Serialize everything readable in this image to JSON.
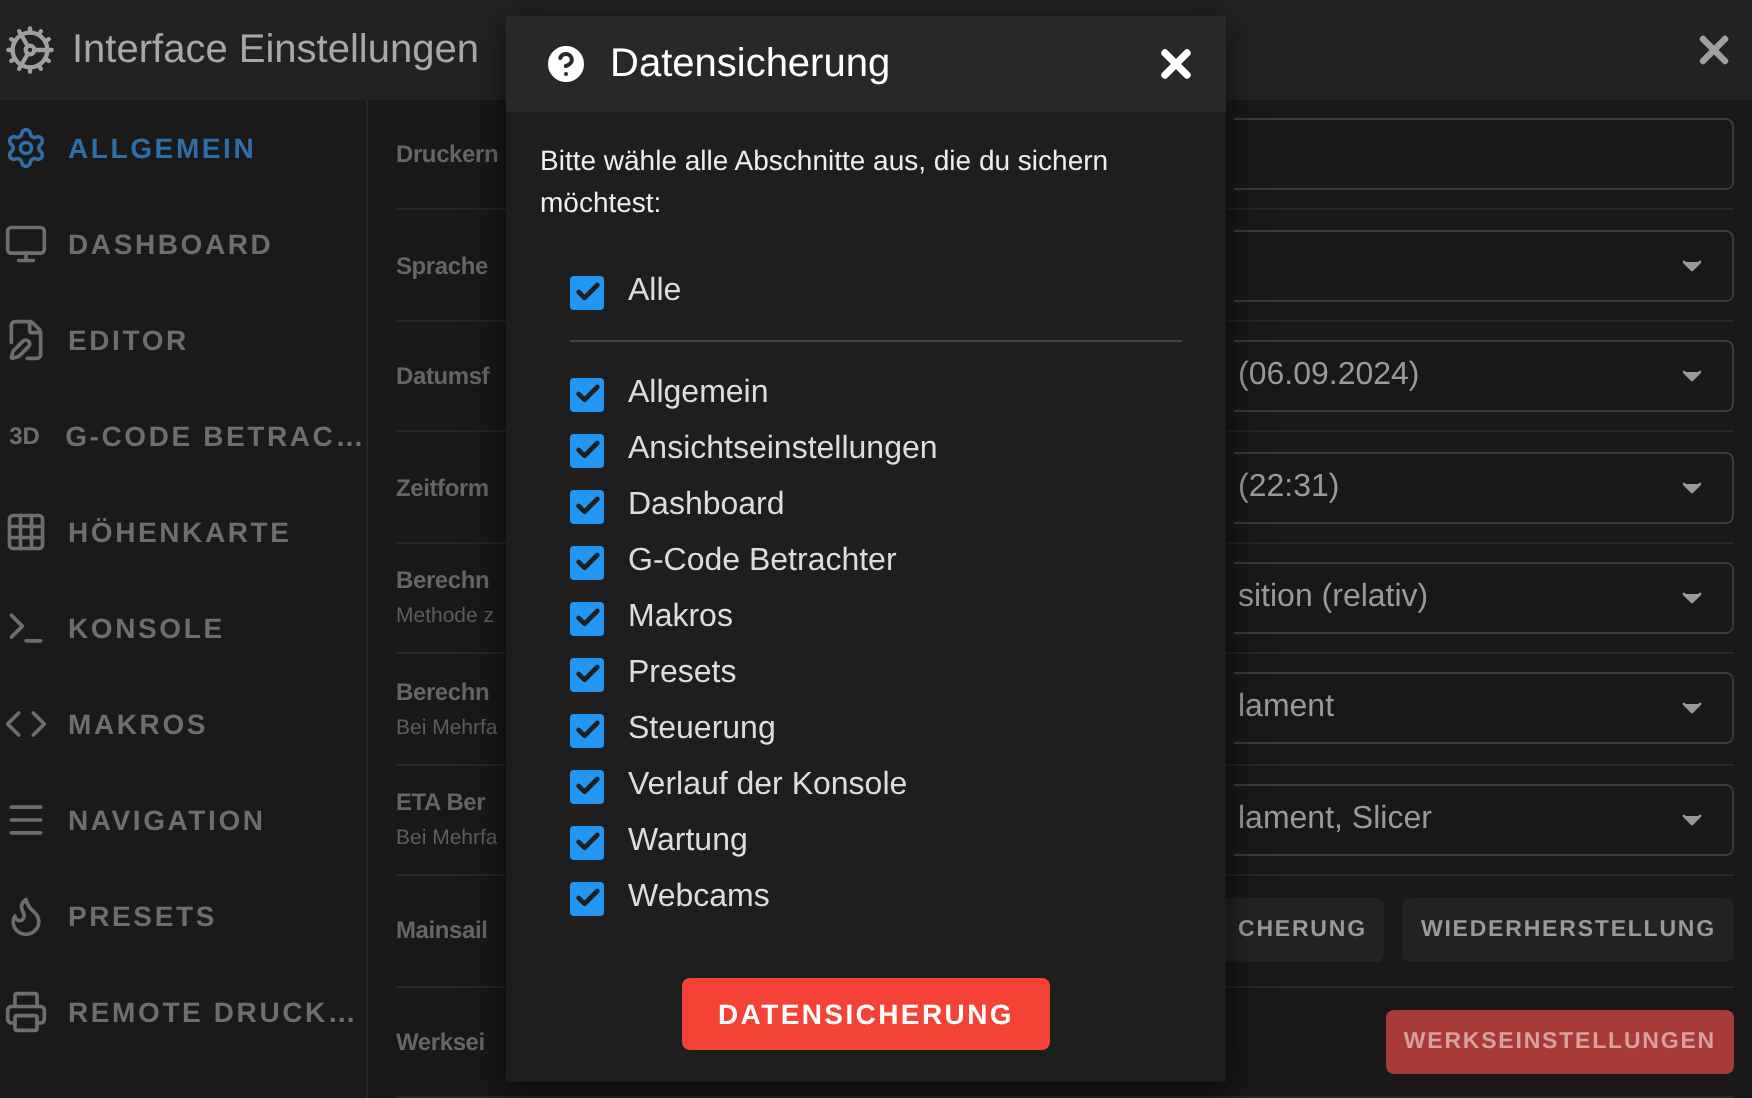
{
  "window": {
    "title": "Interface Einstellungen"
  },
  "sidebar": {
    "items": [
      {
        "label": "ALLGEMEIN",
        "selected": true
      },
      {
        "label": "DASHBOARD",
        "selected": false
      },
      {
        "label": "EDITOR",
        "selected": false
      },
      {
        "label": "G-CODE BETRAC…",
        "selected": false,
        "glyph": "3D"
      },
      {
        "label": "HÖHENKARTE",
        "selected": false
      },
      {
        "label": "KONSOLE",
        "selected": false
      },
      {
        "label": "MAKROS",
        "selected": false
      },
      {
        "label": "NAVIGATION",
        "selected": false
      },
      {
        "label": "PRESETS",
        "selected": false
      },
      {
        "label": "REMOTE DRUCK…",
        "selected": false
      }
    ]
  },
  "settings": {
    "rows": [
      {
        "kind": "field",
        "label": "Druckern"
      },
      {
        "kind": "select",
        "label": "Sprache",
        "value": ""
      },
      {
        "kind": "select",
        "label": "Datumsf",
        "value": "(06.09.2024)"
      },
      {
        "kind": "select",
        "label": "Zeitform",
        "value": "(22:31)"
      },
      {
        "kind": "select",
        "label": "Berechn",
        "hint": "Methode z",
        "value": "sition (relativ)"
      },
      {
        "kind": "select",
        "label": "Berechn",
        "hint": "Bei Mehrfa",
        "value": "lament"
      },
      {
        "kind": "select",
        "label": "ETA Ber",
        "hint": "Bei Mehrfa",
        "value": "lament, Slicer"
      },
      {
        "kind": "buttons",
        "label": "Mainsail",
        "buttons": [
          "CHERUNG",
          "WIEDERHERSTELLUNG"
        ]
      },
      {
        "kind": "danger",
        "label": "Werksei",
        "buttons": [
          "WERKSEINSTELLUNGEN"
        ]
      }
    ]
  },
  "dialog": {
    "title": "Datensicherung",
    "message": "Bitte wähle alle Abschnitte aus, die du sichern möchtest:",
    "all": {
      "label": "Alle",
      "checked": true
    },
    "sections": [
      {
        "label": "Allgemein",
        "checked": true
      },
      {
        "label": "Ansichtseinstellungen",
        "checked": true
      },
      {
        "label": "Dashboard",
        "checked": true
      },
      {
        "label": "G-Code Betrachter",
        "checked": true
      },
      {
        "label": "Makros",
        "checked": true
      },
      {
        "label": "Presets",
        "checked": true
      },
      {
        "label": "Steuerung",
        "checked": true
      },
      {
        "label": "Verlauf der Konsole",
        "checked": true
      },
      {
        "label": "Wartung",
        "checked": true
      },
      {
        "label": "Webcams",
        "checked": true
      }
    ],
    "button": "DATENSICHERUNG"
  }
}
